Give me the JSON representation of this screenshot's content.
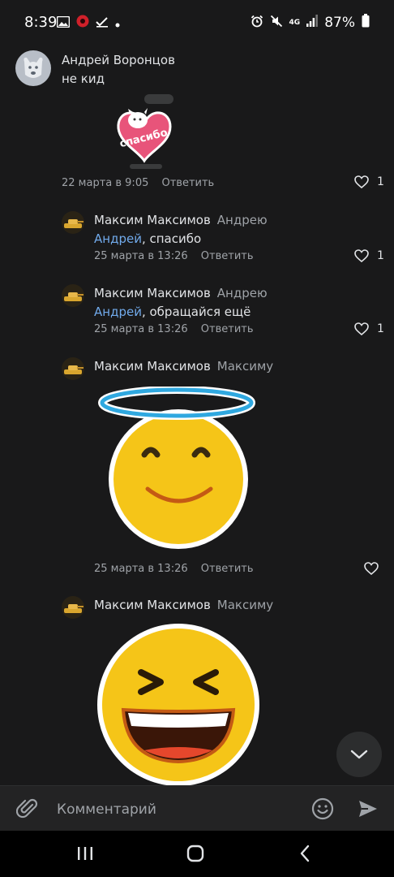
{
  "status_bar": {
    "time": "8:39",
    "network": "4G",
    "battery": "87%"
  },
  "comments": [
    {
      "author": "Андрей Воронцов",
      "text": "не кид",
      "sticker_text": "спасибо",
      "date": "22 марта в 9:05",
      "reply_label": "Ответить",
      "likes": "1"
    },
    {
      "author": "Максим Максимов",
      "reply_to": "Андрею",
      "mention": "Андрей",
      "text_rest": ", спасибо",
      "date": "25 марта в 13:26",
      "reply_label": "Ответить",
      "likes": "1"
    },
    {
      "author": "Максим Максимов",
      "reply_to": "Андрею",
      "mention": "Андрей",
      "text_rest": ", обращайся ещё",
      "date": "25 марта в 13:26",
      "reply_label": "Ответить",
      "likes": "1"
    },
    {
      "author": "Максим Максимов",
      "reply_to": "Максиму",
      "date": "25 марта в 13:26",
      "reply_label": "Ответить",
      "likes": ""
    },
    {
      "author": "Максим Максимов",
      "reply_to": "Максиму"
    }
  ],
  "composer": {
    "placeholder": "Комментарий",
    "value": ""
  },
  "colors": {
    "background": "#19191a",
    "mention": "#71aaeb",
    "secondary_text": "#9fa3a8",
    "emoji_yellow": "#f5c518",
    "halo_blue": "#2fa8e0"
  }
}
